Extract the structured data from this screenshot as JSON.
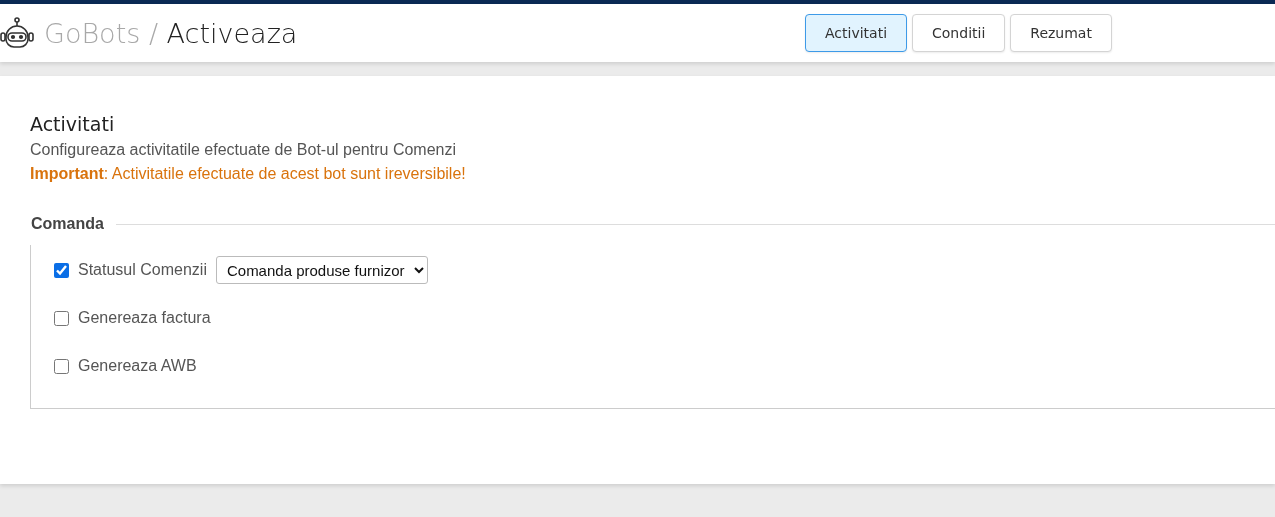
{
  "header": {
    "brand": "GoBots",
    "separator": "/",
    "page": "Activeaza"
  },
  "tabs": [
    {
      "label": "Activitati",
      "selected": true
    },
    {
      "label": "Conditii",
      "selected": false
    },
    {
      "label": "Rezumat",
      "selected": false
    }
  ],
  "section": {
    "title": "Activitati",
    "description": "Configureaza activitatile efectuate de Bot-ul pentru Comenzi",
    "warning": "**Important**: Activitatile efectuate de acest bot sunt ireversibile!"
  },
  "group": {
    "legend": "Comanda",
    "options": [
      {
        "kind": "select",
        "label": "Statusul Comenzii",
        "checked": true,
        "value": "Comanda produse furnizor"
      },
      {
        "kind": "plain",
        "label": "Genereaza factura",
        "checked": false
      },
      {
        "kind": "plain",
        "label": "Genereaza AWB",
        "checked": false
      }
    ]
  }
}
